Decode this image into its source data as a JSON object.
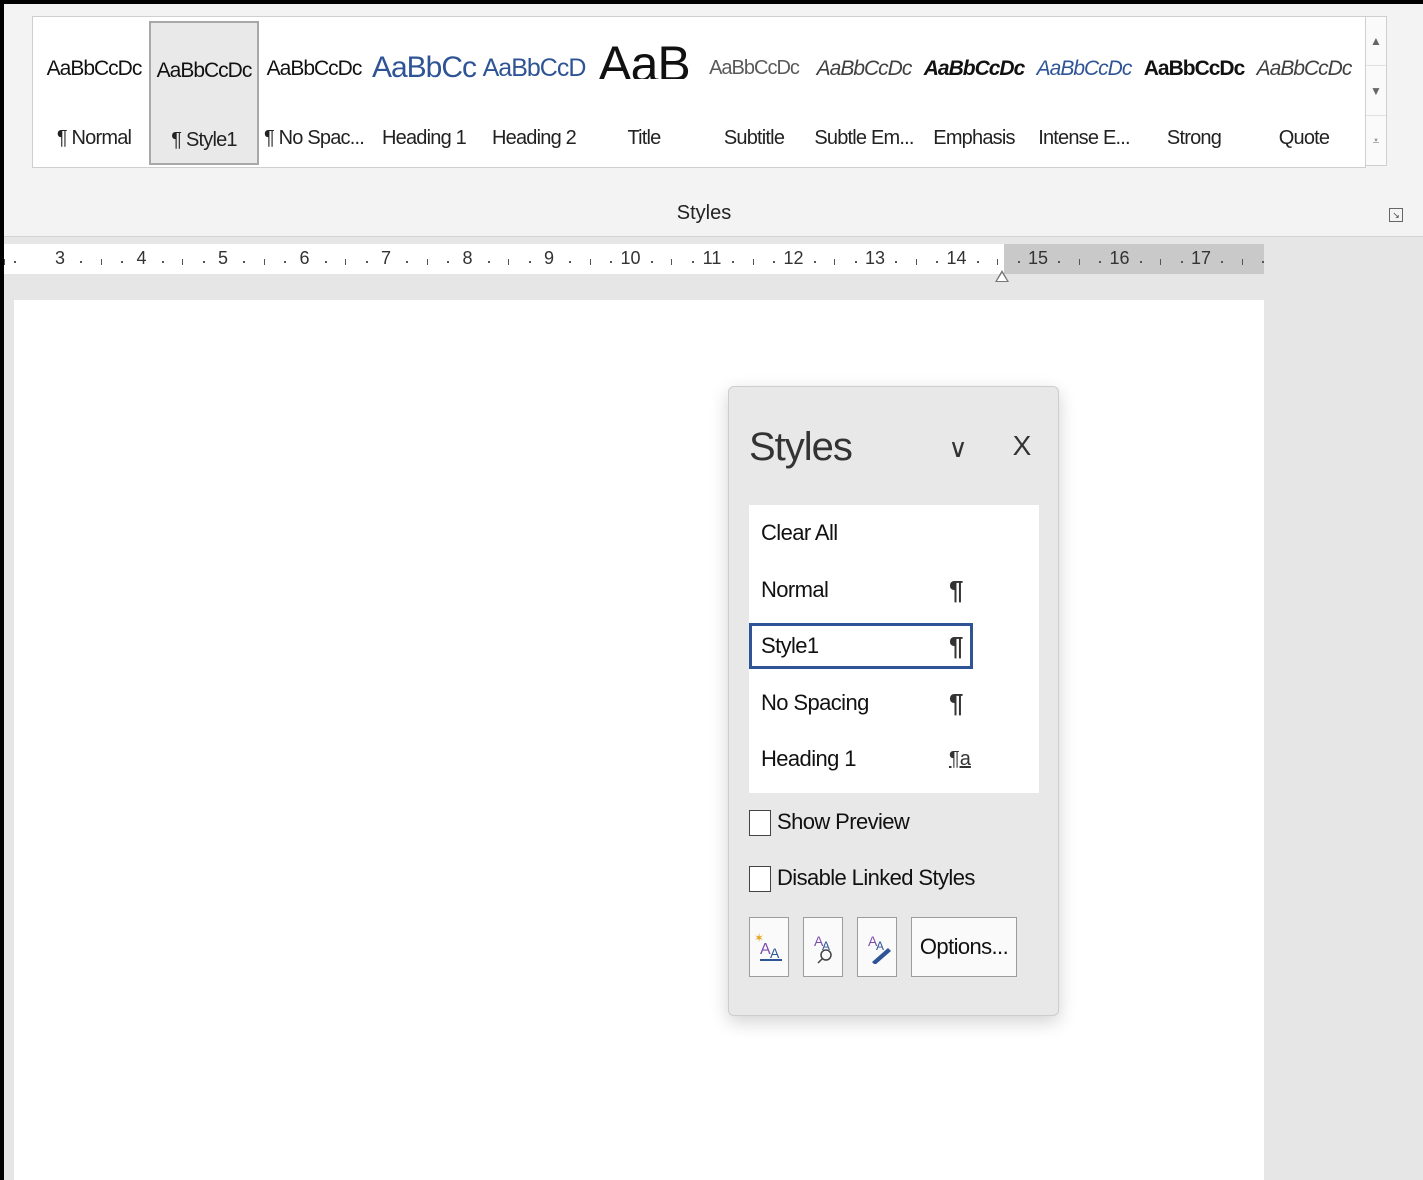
{
  "ribbon": {
    "gallery": [
      {
        "preview": "AaBbCcDc",
        "label": "¶ Normal",
        "preview_color": "#111111",
        "style": "normal"
      },
      {
        "preview": "AaBbCcDc",
        "label": "¶ Style1",
        "preview_color": "#111111",
        "style": "normal",
        "selected": true
      },
      {
        "preview": "AaBbCcDc",
        "label": "¶ No Spac...",
        "preview_color": "#111111",
        "style": "normal"
      },
      {
        "preview": "AaBbCc",
        "label": "Heading 1",
        "preview_color": "#2f5496",
        "style": "h1"
      },
      {
        "preview": "AaBbCcD",
        "label": "Heading 2",
        "preview_color": "#2f5496",
        "style": "h2"
      },
      {
        "preview": "AaB",
        "label": "Title",
        "preview_color": "#111111",
        "style": "title"
      },
      {
        "preview": "AaBbCcDc",
        "label": "Subtitle",
        "preview_color": "#595959",
        "style": "subtitle"
      },
      {
        "preview": "AaBbCcDc",
        "label": "Subtle Em...",
        "preview_color": "#404040",
        "style": "italic"
      },
      {
        "preview": "AaBbCcDc",
        "label": "Emphasis",
        "preview_color": "#111111",
        "style": "italic-bold"
      },
      {
        "preview": "AaBbCcDc",
        "label": "Intense E...",
        "preview_color": "#2f5496",
        "style": "italic"
      },
      {
        "preview": "AaBbCcDc",
        "label": "Strong",
        "preview_color": "#111111",
        "style": "bold"
      },
      {
        "preview": "AaBbCcDc",
        "label": "Quote",
        "preview_color": "#404040",
        "style": "italic"
      }
    ],
    "group_label": "Styles",
    "scroll_up_icon": "chevron-up-icon",
    "scroll_down_icon": "chevron-down-icon",
    "more_icon": "more-styles-icon"
  },
  "ruler": {
    "numbers": [
      "3",
      "4",
      "5",
      "6",
      "7",
      "8",
      "9",
      "10",
      "11",
      "12",
      "13",
      "14",
      "15",
      "16",
      "17"
    ]
  },
  "styles_pane": {
    "title": "Styles",
    "collapse_glyph": "∨",
    "close_glyph": "X",
    "items": [
      {
        "name": "Clear All",
        "mark": ""
      },
      {
        "name": "Normal",
        "mark": "¶"
      },
      {
        "name": "Style1",
        "mark": "¶",
        "selected": true
      },
      {
        "name": "No Spacing",
        "mark": "¶"
      },
      {
        "name": "Heading 1",
        "mark": "¶a"
      }
    ],
    "show_preview_label": "Show Preview",
    "show_preview_checked": false,
    "disable_linked_label": "Disable Linked Styles",
    "disable_linked_checked": false,
    "buttons": {
      "new_style_icon": "new-style-icon",
      "style_inspector_icon": "style-inspector-icon",
      "manage_styles_icon": "manage-styles-icon",
      "options_label": "Options..."
    },
    "selected_border_color": "#2f5496"
  }
}
